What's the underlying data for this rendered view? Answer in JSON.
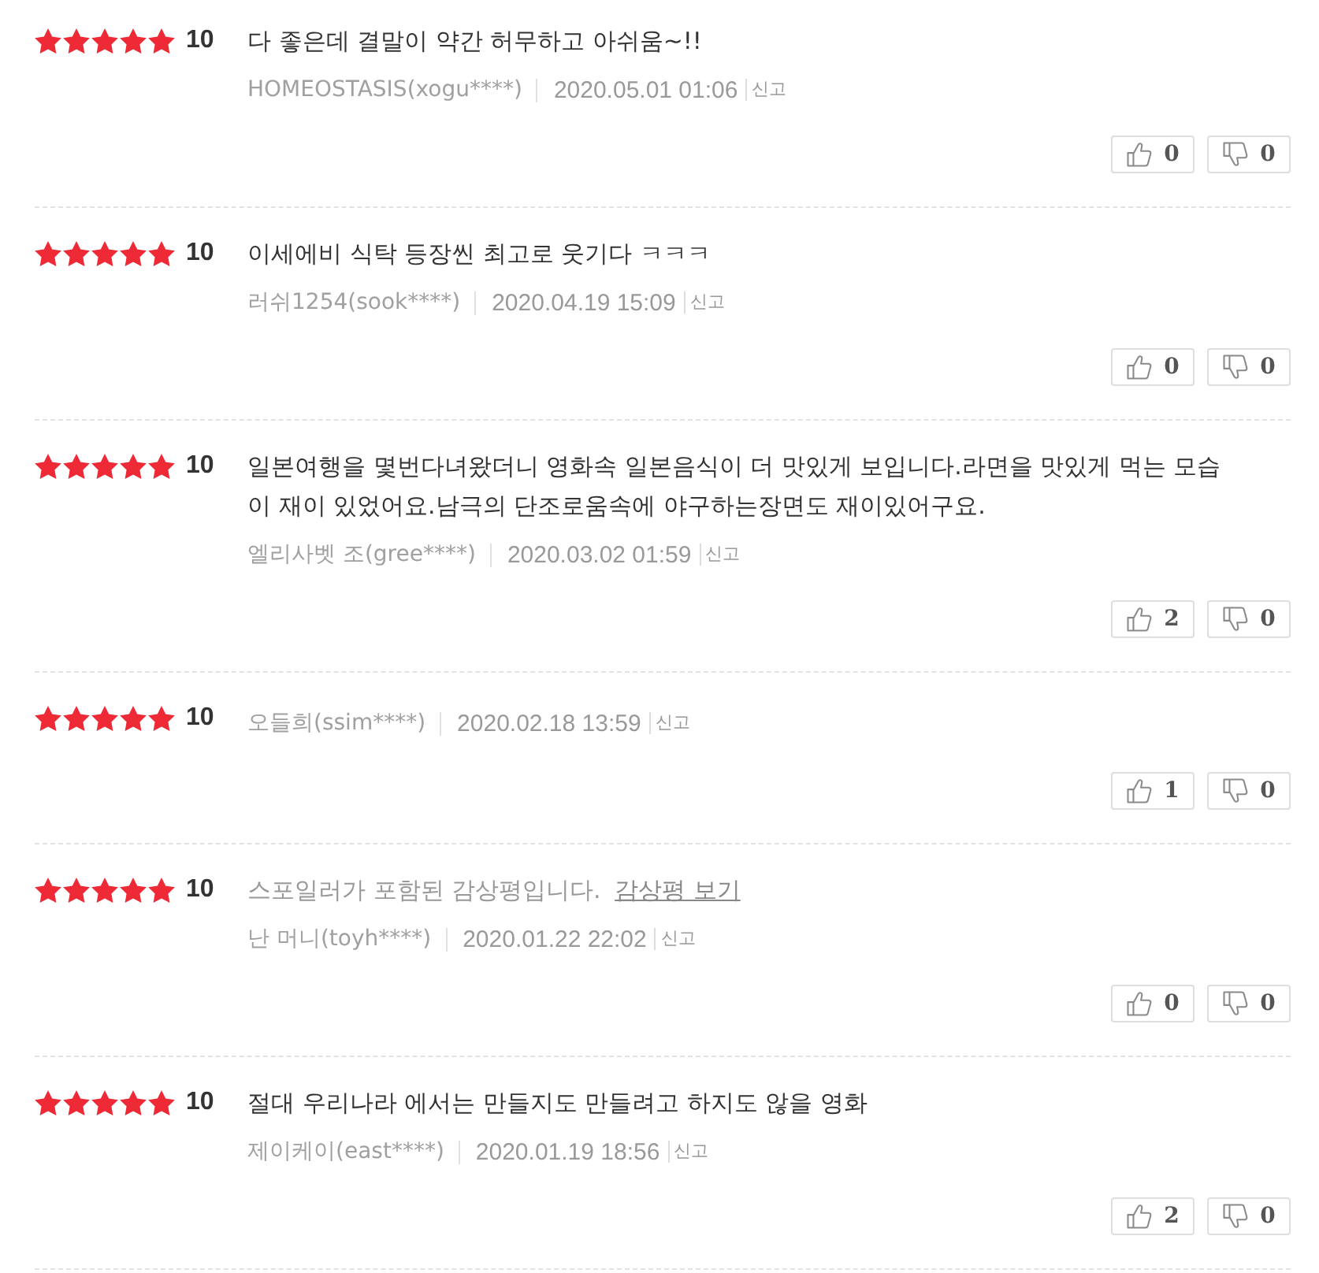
{
  "reviews": [
    {
      "kind": "text",
      "stars": 5,
      "score": "10",
      "comment": "다 좋은데 결말이 약간 허무하고 아쉬움~!!",
      "author": "HOMEOSTASIS(xogu****)",
      "date": "2020.05.01 01:06",
      "report": "신고",
      "likes": "0",
      "dislikes": "0"
    },
    {
      "kind": "text",
      "stars": 5,
      "score": "10",
      "comment": "이세에비 식탁 등장씬 최고로 웃기다 ㅋㅋㅋ",
      "author": "러쉬1254(sook****)",
      "date": "2020.04.19 15:09",
      "report": "신고",
      "likes": "0",
      "dislikes": "0"
    },
    {
      "kind": "text",
      "stars": 5,
      "score": "10",
      "comment": "일본여행을 몇번다녀왔더니 영화속 일본음식이 더 맛있게 보입니다.라면을 맛있게 먹는 모습이 재이 있었어요.남극의 단조로움속에 야구하는장면도 재이있어구요.",
      "author": "엘리사벳 조(gree****)",
      "date": "2020.03.02 01:59",
      "report": "신고",
      "likes": "2",
      "dislikes": "0"
    },
    {
      "kind": "rating_only",
      "stars": 5,
      "score": "10",
      "author": "오들희(ssim****)",
      "date": "2020.02.18 13:59",
      "report": "신고",
      "likes": "1",
      "dislikes": "0"
    },
    {
      "kind": "spoiler",
      "stars": 5,
      "score": "10",
      "notice": "스포일러가 포함된 감상평입니다.",
      "link": "감상평 보기",
      "author": "난 머니(toyh****)",
      "date": "2020.01.22 22:02",
      "report": "신고",
      "likes": "0",
      "dislikes": "0"
    },
    {
      "kind": "text",
      "stars": 5,
      "score": "10",
      "comment": "절대 우리나라 에서는 만들지도 만들려고 하지도 않을 영화",
      "author": "제이케이(east****)",
      "date": "2020.01.19 18:56",
      "report": "신고",
      "likes": "2",
      "dislikes": "0"
    }
  ]
}
